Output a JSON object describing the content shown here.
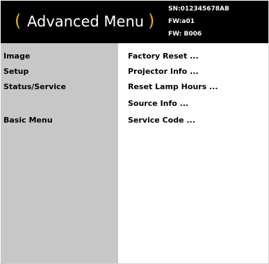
{
  "header": {
    "paren_left": "(",
    "title": "Advanced Menu",
    "paren_right": ")",
    "serial": "SN:012345678AB",
    "fw_a": "FW:a01",
    "fw_b": "FW: B006",
    "colors": {
      "background": "#000000",
      "paren": "#f0b400",
      "text": "#ffffff"
    }
  },
  "sidebar": {
    "items": [
      {
        "label": "Image"
      },
      {
        "label": "Setup"
      },
      {
        "label": "Status/Service"
      },
      {
        "label": "Basic Menu"
      }
    ],
    "colors": {
      "background": "#c7c7c7"
    }
  },
  "main": {
    "items": [
      {
        "label": "Factory Reset ..."
      },
      {
        "label": "Projector Info ..."
      },
      {
        "label": "Reset Lamp Hours ..."
      },
      {
        "label": "Source Info ..."
      },
      {
        "label": "Service Code ..."
      }
    ]
  }
}
